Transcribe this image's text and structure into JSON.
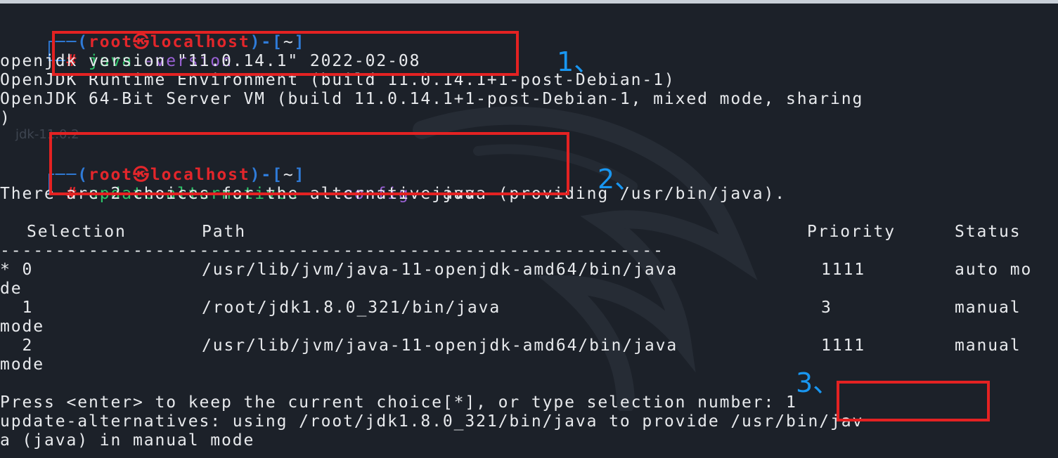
{
  "prompt": {
    "open": "┌──(",
    "user": "root",
    "at": "㉿",
    "host": "localhost",
    "close": ")-[",
    "dir": "~",
    "end": "]",
    "second": "└─",
    "hash": "#"
  },
  "cmd1": {
    "program": "java",
    "arg": "-version"
  },
  "output1": [
    "openjdk version \"11.0.14.1\" 2022-02-08",
    "OpenJDK Runtime Environment (build 11.0.14.1+1-post-Debian-1)",
    "OpenJDK 64-Bit Server VM (build 11.0.14.1+1-post-Debian-1, mixed mode, sharing",
    ")"
  ],
  "faint_text": "jdk-11.0.2",
  "cmd2": {
    "program": "update-alternatives",
    "arg": "--config",
    "value": "java"
  },
  "choices_line": "There are 2 choices for the alternative java (providing /usr/bin/java).",
  "table": {
    "headers": [
      "Selection",
      "Path",
      "Priority",
      "Status"
    ],
    "separator": "------------------------------------------------------------",
    "rows": [
      {
        "sel": "* 0",
        "path": "/usr/lib/jvm/java-11-openjdk-amd64/bin/java",
        "priority": "1111",
        "status": "auto mo",
        "wrap": "de"
      },
      {
        "sel": "  1",
        "path": "/root/jdk1.8.0_321/bin/java",
        "priority": "3",
        "status": "manual",
        "wrap": "mode"
      },
      {
        "sel": "  2",
        "path": "/usr/lib/jvm/java-11-openjdk-amd64/bin/java",
        "priority": "1111",
        "status": "manual",
        "wrap": "mode"
      }
    ]
  },
  "press_line": "Press <enter> to keep the current choice[*], or type selection number: 1",
  "result_lines": [
    "update-alternatives: using /root/jdk1.8.0_321/bin/java to provide /usr/bin/jav",
    "a (java) in manual mode"
  ],
  "annotations": [
    "1、",
    "2、",
    "3、"
  ],
  "colors": {
    "background": "#1c2129",
    "prompt_blue": "#2f7bd8",
    "prompt_red": "#e3262b",
    "command_green": "#2ec66a",
    "argument_purple": "#9b62d6",
    "highlight_box": "#e42222",
    "annotation_blue": "#1996f0"
  }
}
